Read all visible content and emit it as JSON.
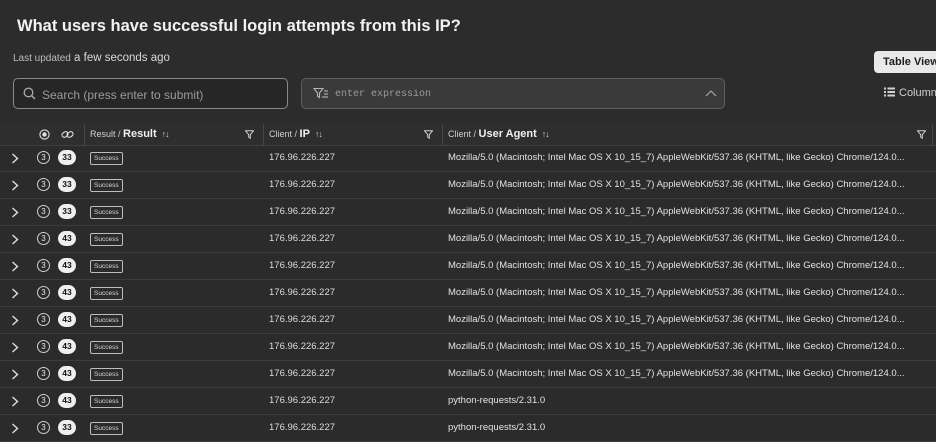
{
  "header": {
    "title": "What users have successful login attempts from this IP?",
    "last_updated_label": "Last updated",
    "last_updated_value": "a few seconds ago",
    "table_view_label": "Table View",
    "columns_label": "Columns"
  },
  "search": {
    "placeholder": "Search (press enter to submit)",
    "value": ""
  },
  "expression": {
    "placeholder": "enter expression",
    "value": ""
  },
  "table": {
    "columns": [
      {
        "prefix": "Result / ",
        "name": "Result"
      },
      {
        "prefix": "Client / ",
        "name": "IP"
      },
      {
        "prefix": "Client / ",
        "name": "User Agent"
      }
    ],
    "sort_glyph": "↑↓",
    "rows": [
      {
        "count_a": "3",
        "count_b": "33",
        "result": "Success",
        "ip": "176.96.226.227",
        "user_agent": "Mozilla/5.0 (Macintosh; Intel Mac OS X 10_15_7) AppleWebKit/537.36 (KHTML, like Gecko) Chrome/124.0..."
      },
      {
        "count_a": "3",
        "count_b": "33",
        "result": "Success",
        "ip": "176.96.226.227",
        "user_agent": "Mozilla/5.0 (Macintosh; Intel Mac OS X 10_15_7) AppleWebKit/537.36 (KHTML, like Gecko) Chrome/124.0..."
      },
      {
        "count_a": "3",
        "count_b": "33",
        "result": "Success",
        "ip": "176.96.226.227",
        "user_agent": "Mozilla/5.0 (Macintosh; Intel Mac OS X 10_15_7) AppleWebKit/537.36 (KHTML, like Gecko) Chrome/124.0..."
      },
      {
        "count_a": "3",
        "count_b": "43",
        "result": "Success",
        "ip": "176.96.226.227",
        "user_agent": "Mozilla/5.0 (Macintosh; Intel Mac OS X 10_15_7) AppleWebKit/537.36 (KHTML, like Gecko) Chrome/124.0..."
      },
      {
        "count_a": "3",
        "count_b": "43",
        "result": "Success",
        "ip": "176.96.226.227",
        "user_agent": "Mozilla/5.0 (Macintosh; Intel Mac OS X 10_15_7) AppleWebKit/537.36 (KHTML, like Gecko) Chrome/124.0..."
      },
      {
        "count_a": "3",
        "count_b": "43",
        "result": "Success",
        "ip": "176.96.226.227",
        "user_agent": "Mozilla/5.0 (Macintosh; Intel Mac OS X 10_15_7) AppleWebKit/537.36 (KHTML, like Gecko) Chrome/124.0..."
      },
      {
        "count_a": "3",
        "count_b": "43",
        "result": "Success",
        "ip": "176.96.226.227",
        "user_agent": "Mozilla/5.0 (Macintosh; Intel Mac OS X 10_15_7) AppleWebKit/537.36 (KHTML, like Gecko) Chrome/124.0..."
      },
      {
        "count_a": "3",
        "count_b": "43",
        "result": "Success",
        "ip": "176.96.226.227",
        "user_agent": "Mozilla/5.0 (Macintosh; Intel Mac OS X 10_15_7) AppleWebKit/537.36 (KHTML, like Gecko) Chrome/124.0..."
      },
      {
        "count_a": "3",
        "count_b": "43",
        "result": "Success",
        "ip": "176.96.226.227",
        "user_agent": "Mozilla/5.0 (Macintosh; Intel Mac OS X 10_15_7) AppleWebKit/537.36 (KHTML, like Gecko) Chrome/124.0..."
      },
      {
        "count_a": "3",
        "count_b": "43",
        "result": "Success",
        "ip": "176.96.226.227",
        "user_agent": "python-requests/2.31.0"
      },
      {
        "count_a": "3",
        "count_b": "33",
        "result": "Success",
        "ip": "176.96.226.227",
        "user_agent": "python-requests/2.31.0"
      }
    ]
  },
  "icons": {
    "search": "search-icon",
    "expression": "filter-expression-icon",
    "dropdown": "chevron-up-icon",
    "columns": "columns-icon",
    "status": "target-icon",
    "link": "link-icon",
    "filter": "funnel-icon",
    "expand": "chevron-right-icon"
  }
}
